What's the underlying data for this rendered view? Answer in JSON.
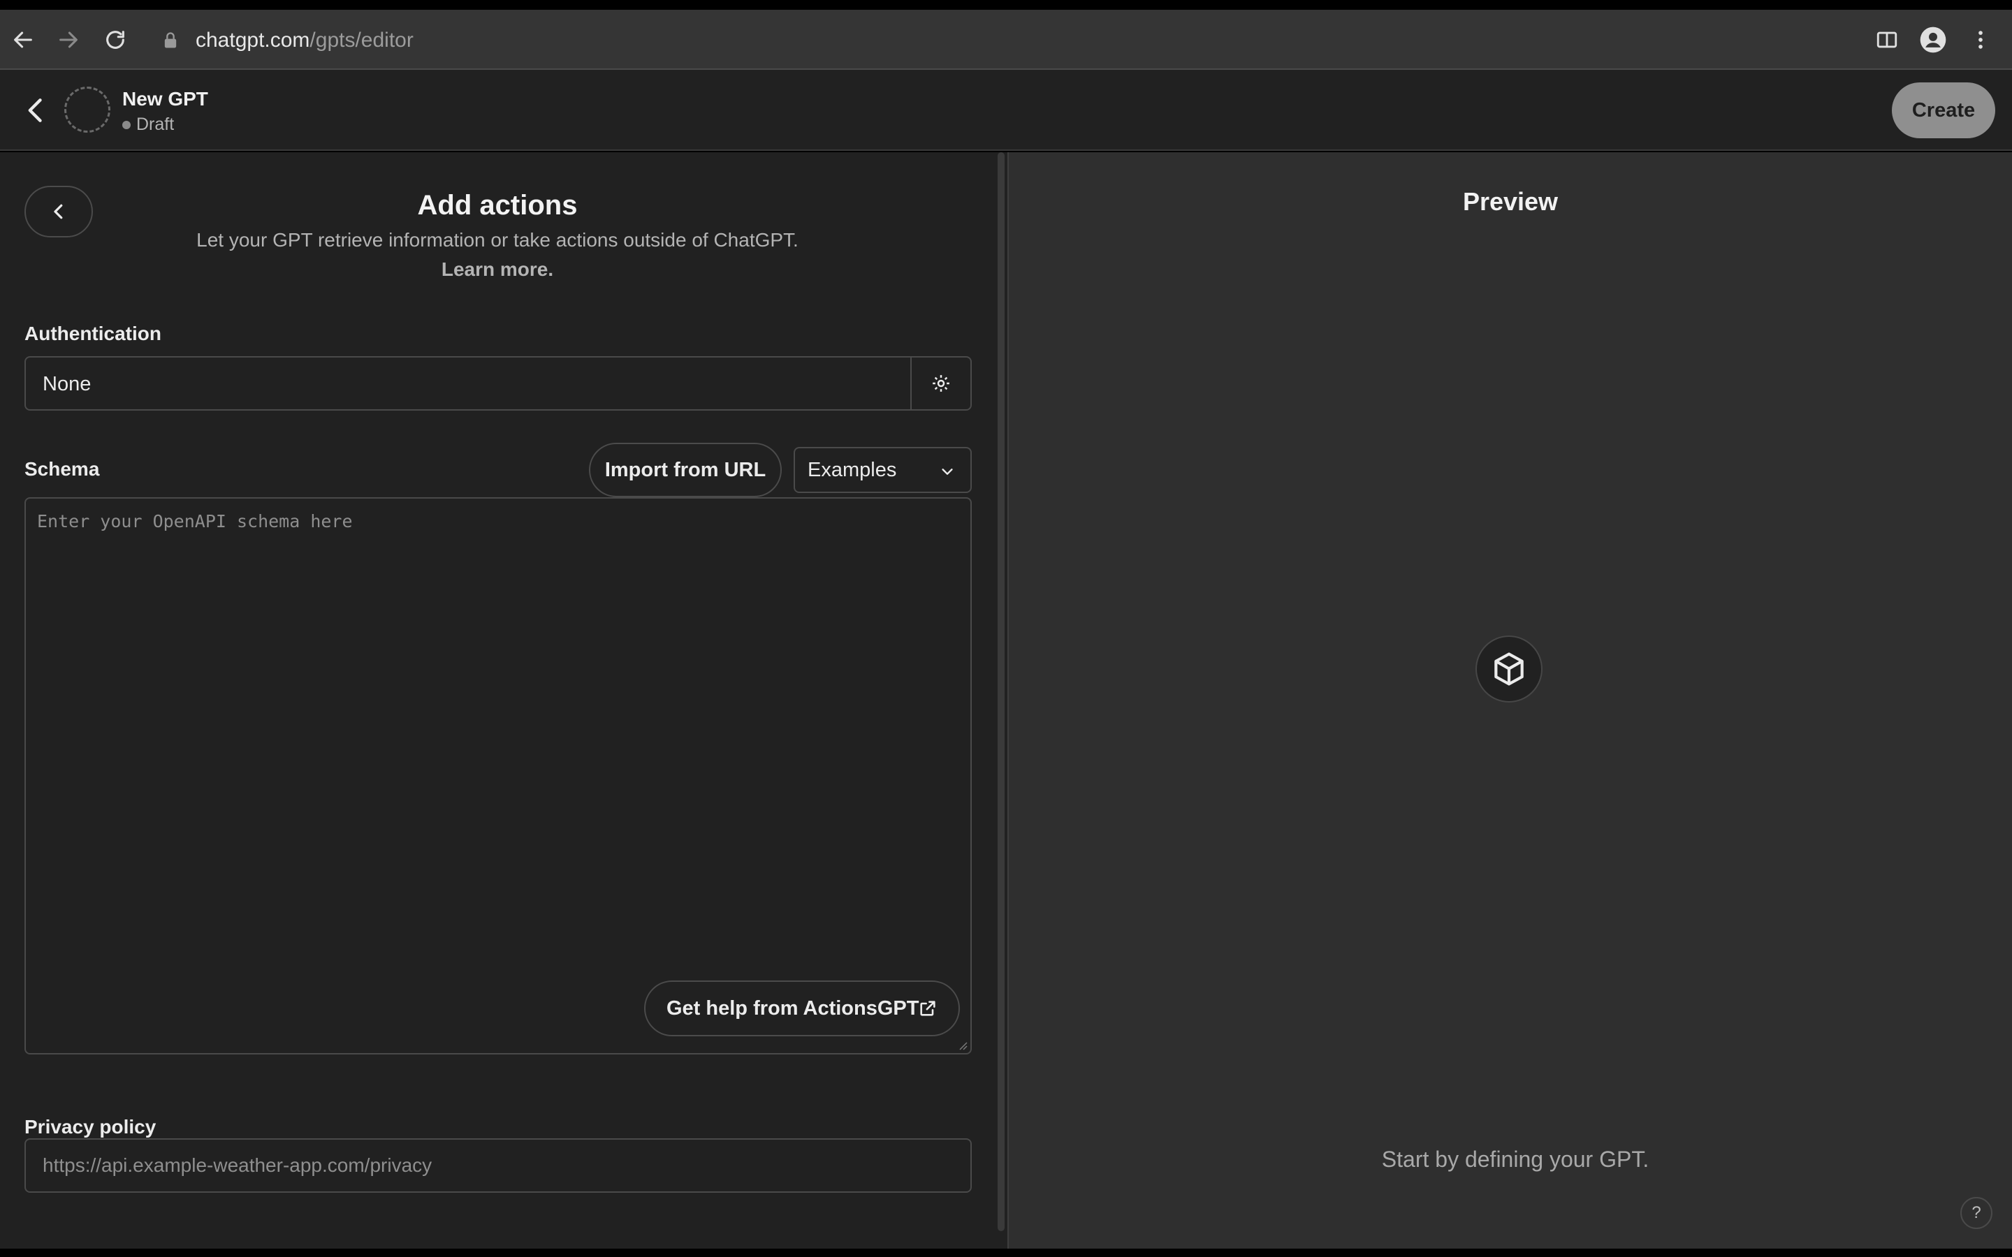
{
  "browser": {
    "url_domain": "chatgpt.com",
    "url_path": "/gpts/editor"
  },
  "header": {
    "gpt_name": "New GPT",
    "status": "Draft",
    "create_label": "Create"
  },
  "actions": {
    "title": "Add actions",
    "subtitle": "Let your GPT retrieve information or take actions outside of ChatGPT.",
    "learn_more": "Learn more.",
    "auth_label": "Authentication",
    "auth_value": "None",
    "schema_label": "Schema",
    "import_label": "Import from URL",
    "examples_label": "Examples",
    "schema_placeholder": "Enter your OpenAPI schema here",
    "helper_label": "Get help from ActionsGPT",
    "privacy_label": "Privacy policy",
    "privacy_placeholder": "https://api.example-weather-app.com/privacy"
  },
  "preview": {
    "title": "Preview",
    "empty_text": "Start by defining your GPT.",
    "help_label": "?"
  },
  "colors": {
    "app_bg": "#212121",
    "preview_bg": "#2f2f2f",
    "chrome_bg": "#353535",
    "border": "#4a4a4a",
    "create_btn": "#8f8f8f"
  }
}
